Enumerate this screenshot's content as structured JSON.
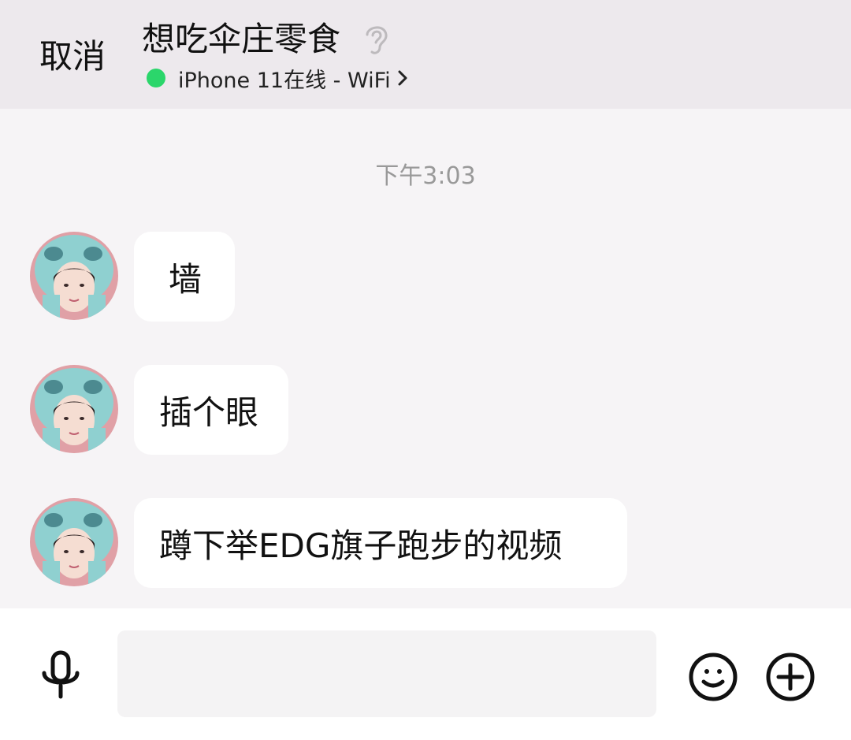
{
  "header": {
    "cancel_label": "取消",
    "title": "想吃伞庄零食",
    "ear_icon": "ear-icon",
    "status_text": "iPhone 11在线 - WiFi",
    "status_color": "#2bd66b"
  },
  "chat": {
    "timestamp": "下午3:03",
    "messages": [
      {
        "text": "墙",
        "avatar": "avatar-stitch-hood-photo"
      },
      {
        "text": "插个眼",
        "avatar": "avatar-stitch-hood-photo"
      },
      {
        "text": "蹲下举EDG旗子跑步的视频",
        "avatar": "avatar-stitch-hood-photo"
      }
    ]
  },
  "composer": {
    "placeholder": "",
    "voice_icon": "microphone-icon",
    "emoji_icon": "smiley-icon",
    "more_icon": "plus-circle-icon"
  }
}
